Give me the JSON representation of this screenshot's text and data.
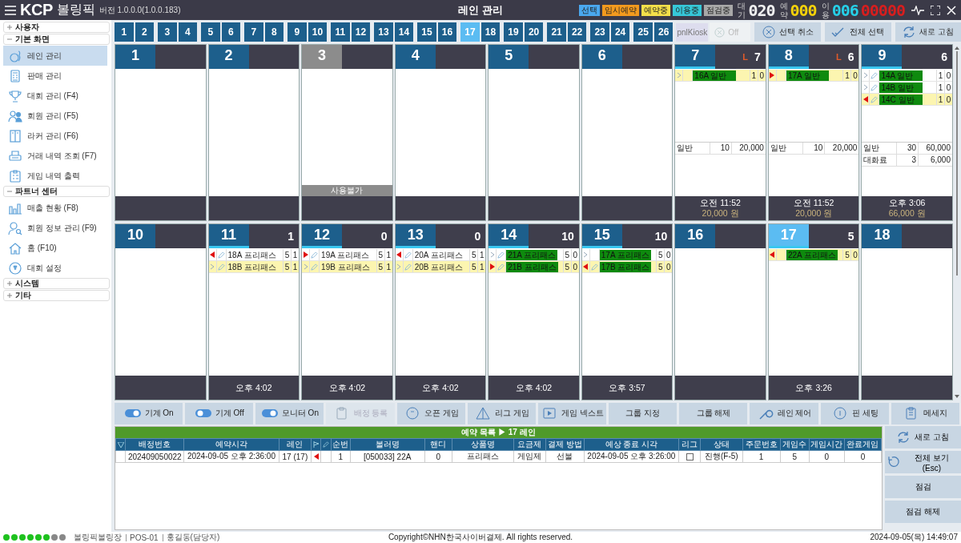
{
  "top_bar": {
    "logo": "KCP",
    "app_name": "볼링픽",
    "version": "버전 1.0.0.0(1.0.0.183)",
    "title": "레인 관리",
    "legend": [
      {
        "label": "선택",
        "color": "#4aa8ef"
      },
      {
        "label": "임시예약",
        "color": "#f39a1e"
      },
      {
        "label": "예약중",
        "color": "#f5e04a"
      },
      {
        "label": "이용중",
        "color": "#36c8d8"
      },
      {
        "label": "점검중",
        "color": "#a8a8a8"
      }
    ],
    "counters": [
      {
        "label": "대기",
        "value": "020",
        "color": "#f0f0f0"
      },
      {
        "label": "예약",
        "value": "000",
        "color": "#f5d20a"
      },
      {
        "label": "이용",
        "value": "006",
        "color": "#26d0e8"
      },
      {
        "value": "00000",
        "color": "#d81e1e"
      }
    ]
  },
  "lane_tabs": [
    {
      "label": "1",
      "selected": false
    },
    {
      "label": "2",
      "selected": false
    },
    {
      "label": "3",
      "selected": false
    },
    {
      "label": "4",
      "selected": false
    },
    {
      "label": "5",
      "selected": false
    },
    {
      "label": "6",
      "selected": false
    },
    {
      "label": "7",
      "selected": false
    },
    {
      "label": "8",
      "selected": false
    },
    {
      "label": "9",
      "selected": false
    },
    {
      "label": "10",
      "selected": false
    },
    {
      "label": "11",
      "selected": false
    },
    {
      "label": "12",
      "selected": false
    },
    {
      "label": "13",
      "selected": false
    },
    {
      "label": "14",
      "selected": false
    },
    {
      "label": "15",
      "selected": false
    },
    {
      "label": "16",
      "selected": false
    },
    {
      "label": "17",
      "selected": true
    },
    {
      "label": "18",
      "selected": false
    },
    {
      "label": "19",
      "selected": false
    },
    {
      "label": "20",
      "selected": false
    },
    {
      "label": "21",
      "selected": false
    },
    {
      "label": "22",
      "selected": false
    },
    {
      "label": "23",
      "selected": false
    },
    {
      "label": "24",
      "selected": false
    },
    {
      "label": "25",
      "selected": false
    },
    {
      "label": "26",
      "selected": false
    }
  ],
  "kiosk": {
    "label": "pnlKiosk",
    "toggle_label": "Off",
    "disabled": true
  },
  "top_buttons": [
    "선택 취소",
    "전체 선택",
    "새로 고침"
  ],
  "sidebar": {
    "groups": [
      {
        "label": "사용자",
        "expanded": false
      },
      {
        "label": "기본 화면",
        "expanded": true,
        "items": [
          {
            "label": "레인 관리",
            "selected": true
          },
          {
            "label": "판매 관리",
            "selected": false
          },
          {
            "label": "대회 관리 (F4)",
            "selected": false
          },
          {
            "label": "회원 관리 (F5)",
            "selected": false
          },
          {
            "label": "라커 관리 (F6)",
            "selected": false
          },
          {
            "label": "거래 내역 조회 (F7)",
            "selected": false
          },
          {
            "label": "게임 내역 출력",
            "selected": false
          }
        ]
      },
      {
        "label": "파트너 센터",
        "expanded": true,
        "items": [
          {
            "label": "매출 현황 (F8)",
            "selected": false
          },
          {
            "label": "회원 정보 관리 (F9)",
            "selected": false
          },
          {
            "label": "홈 (F10)",
            "selected": false
          },
          {
            "label": "대회 설정",
            "selected": false
          }
        ]
      },
      {
        "label": "시스템",
        "expanded": false
      },
      {
        "label": "기타",
        "expanded": false
      }
    ]
  },
  "lanes": [
    {
      "number": "1",
      "selected": false,
      "unavailable": false,
      "active": false
    },
    {
      "number": "2",
      "selected": false,
      "unavailable": false,
      "active": false
    },
    {
      "number": "3",
      "selected": false,
      "unavailable": true,
      "active": false,
      "notice": "사용불가"
    },
    {
      "number": "4",
      "selected": false,
      "unavailable": false,
      "active": false
    },
    {
      "number": "5",
      "selected": false,
      "unavailable": false,
      "active": false
    },
    {
      "number": "6",
      "selected": false,
      "unavailable": false,
      "active": false
    },
    {
      "number": "7",
      "selected": false,
      "unavailable": false,
      "active": true,
      "league_mark": "L",
      "count": "7",
      "games": [
        {
          "kind": "next",
          "pen": false,
          "name": "16A 일반",
          "playing": true,
          "current": true,
          "value_1": "1",
          "value_2": "0"
        }
      ],
      "charges": [
        {
          "name": "일반",
          "qty": "10",
          "amount": "20,000"
        }
      ],
      "time": "오전 11:52",
      "total": "20,000 원"
    },
    {
      "number": "8",
      "selected": false,
      "unavailable": false,
      "active": true,
      "league_mark": "L",
      "count": "6",
      "games": [
        {
          "kind": "right",
          "pen": false,
          "name": "17A 일반",
          "playing": true,
          "current": true,
          "value_1": "1",
          "value_2": "0"
        }
      ],
      "charges": [
        {
          "name": "일반",
          "qty": "10",
          "amount": "20,000"
        }
      ],
      "time": "오전 11:52",
      "total": "20,000 원"
    },
    {
      "number": "9",
      "selected": false,
      "unavailable": false,
      "active": true,
      "count": "6",
      "games": [
        {
          "kind": "next",
          "pen": true,
          "name": "14A 일반",
          "playing": true,
          "current": false,
          "value_1": "1",
          "value_2": "0"
        },
        {
          "kind": "next",
          "pen": true,
          "name": "14B 일반",
          "playing": true,
          "current": false,
          "value_1": "1",
          "value_2": "0"
        },
        {
          "kind": "left",
          "pen": true,
          "name": "14C 일반",
          "playing": true,
          "current": true,
          "value_1": "1",
          "value_2": "0"
        }
      ],
      "charges": [
        {
          "name": "일반",
          "qty": "30",
          "amount": "60,000"
        },
        {
          "name": "대화료",
          "qty": "3",
          "amount": "6,000"
        }
      ],
      "time": "오후 3:06",
      "total": "66,000 원"
    },
    {
      "number": "10",
      "selected": false,
      "unavailable": false,
      "active": false
    },
    {
      "number": "11",
      "selected": false,
      "unavailable": false,
      "active": true,
      "count": "1",
      "games": [
        {
          "kind": "left",
          "pen": true,
          "name": "18A 프리패스",
          "playing": false,
          "current": false,
          "value_1": "5",
          "value_2": "1"
        },
        {
          "kind": "next",
          "pen": true,
          "name": "18B 프리패스",
          "playing": false,
          "current": true,
          "value_1": "5",
          "value_2": "1"
        }
      ],
      "time": "오후 4:02"
    },
    {
      "number": "12",
      "selected": false,
      "unavailable": false,
      "active": true,
      "count": "0",
      "games": [
        {
          "kind": "right",
          "pen": true,
          "name": "19A 프리패스",
          "playing": false,
          "current": false,
          "value_1": "5",
          "value_2": "1"
        },
        {
          "kind": "next",
          "pen": true,
          "name": "19B 프리패스",
          "playing": false,
          "current": true,
          "value_1": "5",
          "value_2": "1"
        }
      ],
      "time": "오후 4:02"
    },
    {
      "number": "13",
      "selected": false,
      "unavailable": false,
      "active": true,
      "count": "0",
      "games": [
        {
          "kind": "left",
          "pen": true,
          "name": "20A 프리패스",
          "playing": false,
          "current": false,
          "value_1": "5",
          "value_2": "1"
        },
        {
          "kind": "next",
          "pen": true,
          "name": "20B 프리패스",
          "playing": false,
          "current": true,
          "value_1": "5",
          "value_2": "1"
        }
      ],
      "time": "오후 4:02"
    },
    {
      "number": "14",
      "selected": false,
      "unavailable": false,
      "active": true,
      "count": "10",
      "games": [
        {
          "kind": "next",
          "pen": true,
          "name": "21A 프리패스",
          "playing": true,
          "current": false,
          "value_1": "5",
          "value_2": "0"
        },
        {
          "kind": "right",
          "pen": true,
          "name": "21B 프리패스",
          "playing": true,
          "current": true,
          "value_1": "5",
          "value_2": "0"
        }
      ],
      "time": "오후 4:02"
    },
    {
      "number": "15",
      "selected": false,
      "unavailable": false,
      "active": true,
      "count": "10",
      "games": [
        {
          "kind": "next",
          "pen": false,
          "name": "17A 프리패스",
          "playing": true,
          "current": false,
          "value_1": "5",
          "value_2": "0"
        },
        {
          "kind": "left",
          "pen": true,
          "name": "17B 프리패스",
          "playing": true,
          "current": true,
          "value_1": "5",
          "value_2": "0"
        }
      ],
      "time": "오후 3:57"
    },
    {
      "number": "16",
      "selected": false,
      "unavailable": false,
      "active": false
    },
    {
      "number": "17",
      "selected": true,
      "unavailable": false,
      "active": true,
      "count": "5",
      "games": [
        {
          "kind": "left",
          "pen": false,
          "name": "22A 프리패스",
          "playing": true,
          "current": true,
          "value_1": "5",
          "value_2": "0"
        }
      ],
      "time": "오후 3:26"
    },
    {
      "number": "18",
      "selected": false,
      "unavailable": false,
      "active": false
    }
  ],
  "action_buttons": [
    {
      "label": "기계 On",
      "disabled": false
    },
    {
      "label": "기계 Off",
      "disabled": false
    },
    {
      "label": "모니터 On",
      "disabled": false
    },
    {
      "label": "배정 등록",
      "disabled": true
    },
    {
      "label": "오픈 게임",
      "disabled": false
    },
    {
      "label": "리그 게임",
      "disabled": false
    },
    {
      "label": "게임 넥스트",
      "disabled": false
    },
    {
      "label": "그룹 지정",
      "disabled": false
    },
    {
      "label": "그룹 해제",
      "disabled": false
    },
    {
      "label": "레인 제어",
      "disabled": false
    },
    {
      "label": "핀 세팅",
      "disabled": false
    },
    {
      "label": "메세지",
      "disabled": false
    }
  ],
  "reservations": {
    "title": "예약 목록 ▶ 17 레인",
    "columns": [
      {
        "kind": "filter"
      },
      {
        "kind": "text",
        "label": "배정번호"
      },
      {
        "kind": "text",
        "label": "예약시각"
      },
      {
        "kind": "text",
        "label": "레인"
      },
      {
        "kind": "flag"
      },
      {
        "kind": "pen"
      },
      {
        "kind": "text",
        "label": "순번"
      },
      {
        "kind": "text",
        "label": "볼러명"
      },
      {
        "kind": "text",
        "label": "핸디"
      },
      {
        "kind": "text",
        "label": "상품명"
      },
      {
        "kind": "text",
        "label": "요금제"
      },
      {
        "kind": "text",
        "label": "결제 방법"
      },
      {
        "kind": "text",
        "label": "예상 종료 시각"
      },
      {
        "kind": "text",
        "label": "리그"
      },
      {
        "kind": "text",
        "label": "상태"
      },
      {
        "kind": "text",
        "label": "주문번호"
      },
      {
        "kind": "text",
        "label": "게임수"
      },
      {
        "kind": "text",
        "label": "게임시간"
      },
      {
        "kind": "text",
        "label": "완료게임"
      }
    ],
    "rows": [
      {
        "number": "202409050022",
        "time": "2024-09-05 오후 2:36:00",
        "lane": "17 (17)",
        "kind": "left",
        "order": "1",
        "bowler": "[050033] 22A",
        "handicap": "0",
        "product": "프리패스",
        "plan": "게임제",
        "payment": "선불",
        "end_time": "2024-09-05 오후 3:26:00",
        "league": false,
        "status": "진행(F-5)",
        "order_no": "1",
        "games": "5",
        "game_time": "0",
        "done": "0"
      }
    ]
  },
  "side_buttons": [
    "새로 고침",
    "전체 보기 (Esc)",
    "점검",
    "점검 해제"
  ],
  "status_bar": {
    "lights": [
      {
        "on": true
      },
      {
        "on": true
      },
      {
        "on": true
      },
      {
        "on": true
      },
      {
        "on": true
      },
      {
        "on": true
      },
      {
        "on": false
      },
      {
        "on": false
      }
    ],
    "info": [
      "볼링픽볼링장",
      "POS-01",
      "홍길동(담당자)"
    ],
    "copyright": "Copyright©NHN한국사이버결제. All rights reserved.",
    "datetime": "2024-09-05(목) 14:49:07"
  }
}
